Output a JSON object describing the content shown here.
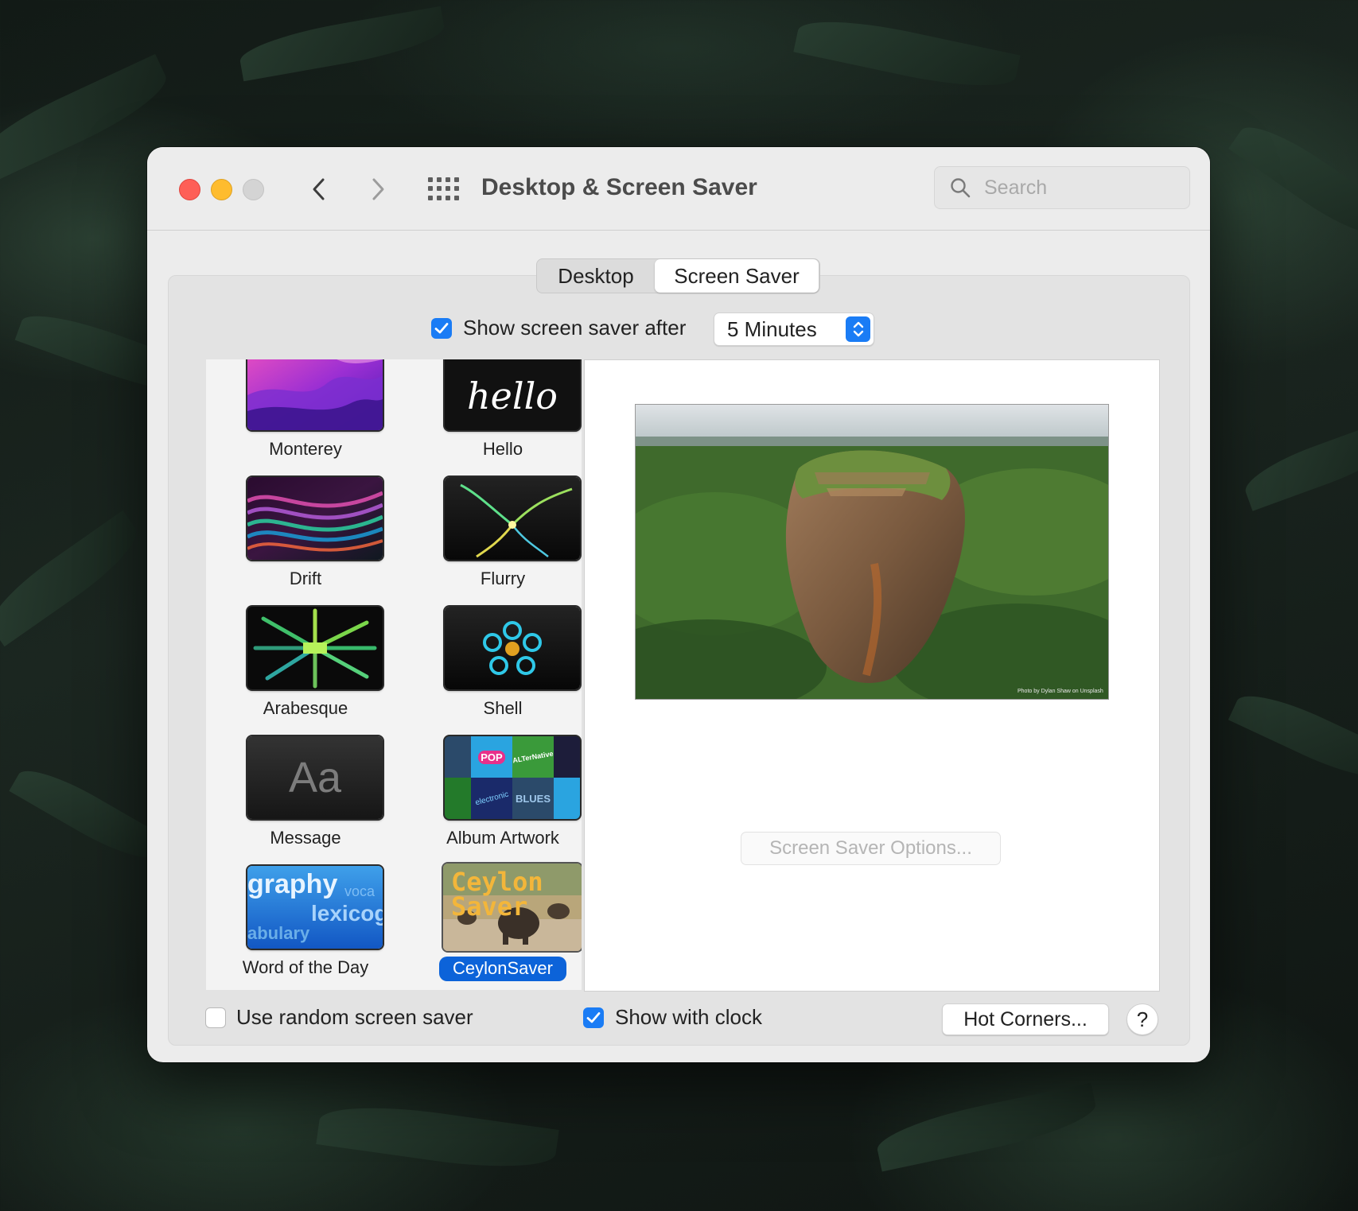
{
  "window": {
    "title": "Desktop & Screen Saver",
    "search_placeholder": "Search"
  },
  "tabs": [
    {
      "label": "Desktop",
      "selected": false
    },
    {
      "label": "Screen Saver",
      "selected": true
    }
  ],
  "show_after": {
    "label": "Show screen saver after",
    "checked": true,
    "value": "5 Minutes"
  },
  "screensavers": [
    {
      "label": "Monterey",
      "icon": "monterey-thumbnail"
    },
    {
      "label": "Hello",
      "icon": "hello-thumbnail",
      "thumb_text": "hello"
    },
    {
      "label": "Drift",
      "icon": "drift-thumbnail"
    },
    {
      "label": "Flurry",
      "icon": "flurry-thumbnail"
    },
    {
      "label": "Arabesque",
      "icon": "arabesque-thumbnail"
    },
    {
      "label": "Shell",
      "icon": "shell-thumbnail"
    },
    {
      "label": "Message",
      "icon": "message-thumbnail",
      "thumb_text": "Aa"
    },
    {
      "label": "Album Artwork",
      "icon": "album-artwork-thumbnail",
      "thumb_words": [
        "POP",
        "ALTerNative",
        "electronic",
        "BLUES"
      ]
    },
    {
      "label": "Word of the Day",
      "icon": "word-of-the-day-thumbnail",
      "thumb_words": [
        "graphy",
        "voca",
        "lexicog",
        "abulary"
      ]
    },
    {
      "label": "CeylonSaver",
      "icon": "ceylonsaver-thumbnail",
      "selected": true,
      "thumb_text": "Ceylon Saver"
    }
  ],
  "preview": {
    "icon": "sigiriya-rock-photo",
    "credit": "Photo by Dylan Shaw on Unsplash",
    "options_button": "Screen Saver Options..."
  },
  "bottom": {
    "random_label": "Use random screen saver",
    "random_checked": false,
    "clock_label": "Show with clock",
    "clock_checked": true,
    "hot_corners": "Hot Corners...",
    "help": "?"
  },
  "colors": {
    "accent": "#1a7cf5",
    "selection": "#0c63d9",
    "close": "#fe5f57",
    "minimize": "#febc2e"
  }
}
